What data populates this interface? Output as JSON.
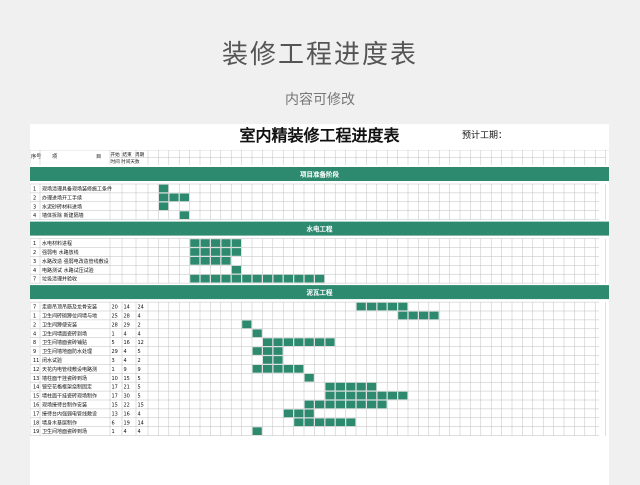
{
  "page": {
    "title": "装修工程进度表",
    "subtitle": "内容可修改"
  },
  "sheet": {
    "title": "室内精装修工程进度表",
    "est_label": "预计工期：",
    "head": {
      "no": "序号",
      "item_a": "项",
      "item_b": "目",
      "start_period": "开始",
      "end_period": "结束",
      "period": "周期",
      "row2": "时间 时间天数"
    },
    "day_count": 44,
    "colors": {
      "header": "#2e8a6e",
      "bar": "#2e8a6e",
      "grid": "#bfbfbf"
    },
    "sections": [
      {
        "title": "项目准备阶段",
        "tasks": [
          {
            "no": "1",
            "name": "现场清理具备现场装修施工条件",
            "start": "",
            "end": "",
            "days": "",
            "bar": [
              1,
              1
            ]
          },
          {
            "no": "2",
            "name": "办理进场开工手续",
            "start": "",
            "end": "",
            "days": "",
            "bar": [
              1,
              3
            ]
          },
          {
            "no": "3",
            "name": "水泥砂砖材料进场",
            "start": "",
            "end": "",
            "days": "",
            "bar": [
              1,
              1
            ]
          },
          {
            "no": "4",
            "name": "墙体拆除 新建隔墙",
            "start": "",
            "end": "",
            "days": "",
            "bar": [
              3,
              1
            ]
          }
        ]
      },
      {
        "title": "水电工程",
        "tasks": [
          {
            "no": "1",
            "name": "水电材料进程",
            "start": "",
            "end": "",
            "days": "",
            "bar": [
              4,
              5
            ]
          },
          {
            "no": "2",
            "name": "强弱电 水路放线",
            "start": "",
            "end": "",
            "days": "",
            "bar": [
              4,
              5
            ]
          },
          {
            "no": "3",
            "name": "水路改造 强弱电改造管线敷设",
            "start": "",
            "end": "",
            "days": "",
            "bar": [
              4,
              4
            ]
          },
          {
            "no": "4",
            "name": "电路测试 水路试压试验",
            "start": "",
            "end": "",
            "days": "",
            "bar": [
              8,
              1
            ]
          },
          {
            "no": "7",
            "name": "垃圾清理并验收",
            "start": "",
            "end": "",
            "days": "",
            "bar": [
              4,
              13
            ]
          }
        ]
      },
      {
        "title": "泥瓦工程",
        "tasks": [
          {
            "no": "7",
            "name": "走廊吊顶吊筋及龙骨安装",
            "start": "20",
            "end": "14",
            "days": "24",
            "bar": [
              20,
              5
            ]
          },
          {
            "no": "1",
            "name": "卫生间砖砌蹲位间墙与地",
            "start": "25",
            "end": "28",
            "days": "4",
            "bar": [
              24,
              4
            ]
          },
          {
            "no": "2",
            "name": "卫生间蹲便安装",
            "start": "28",
            "end": "29",
            "days": "2",
            "bar": [
              9,
              1
            ]
          },
          {
            "no": "4",
            "name": "卫生间墙面瓷砖到场",
            "start": "1",
            "end": "4",
            "days": "4",
            "bar": [
              10,
              1
            ]
          },
          {
            "no": "8",
            "name": "卫生间墙面瓷砖铺贴",
            "start": "5",
            "end": "16",
            "days": "12",
            "bar": [
              11,
              7
            ]
          },
          {
            "no": "9",
            "name": "卫生间墙地面防水处理",
            "start": "29",
            "end": "4",
            "days": "5",
            "bar": [
              10,
              3
            ]
          },
          {
            "no": "11",
            "name": "闭水试验",
            "start": "3",
            "end": "4",
            "days": "2",
            "bar": [
              11,
              2
            ]
          },
          {
            "no": "12",
            "name": "天花内电管线敷设电路测",
            "start": "1",
            "end": "9",
            "days": "9",
            "bar": [
              10,
              5
            ]
          },
          {
            "no": "13",
            "name": "墙柱面干挂瓷砖到场",
            "start": "10",
            "end": "15",
            "days": "5",
            "bar": [
              15,
              1
            ]
          },
          {
            "no": "14",
            "name": "镜空花格框架烧制固定",
            "start": "17",
            "end": "21",
            "days": "5",
            "bar": [
              17,
              5
            ]
          },
          {
            "no": "15",
            "name": "墙柱面干挂瓷砖现场制作",
            "start": "17",
            "end": "30",
            "days": "5",
            "bar": [
              17,
              8
            ]
          },
          {
            "no": "16",
            "name": "现场接待台制作安装",
            "start": "15",
            "end": "22",
            "days": "15",
            "bar": [
              15,
              8
            ]
          },
          {
            "no": "17",
            "name": "接待台内强弱电管线敷设",
            "start": "13",
            "end": "16",
            "days": "4",
            "bar": [
              13,
              3
            ]
          },
          {
            "no": "18",
            "name": "墙身木基层制作",
            "start": "6",
            "end": "19",
            "days": "14",
            "bar": [
              14,
              6
            ]
          },
          {
            "no": "19",
            "name": "卫生间地面瓷砖到场",
            "start": "1",
            "end": "4",
            "days": "4",
            "bar": [
              10,
              1
            ]
          }
        ]
      }
    ]
  }
}
